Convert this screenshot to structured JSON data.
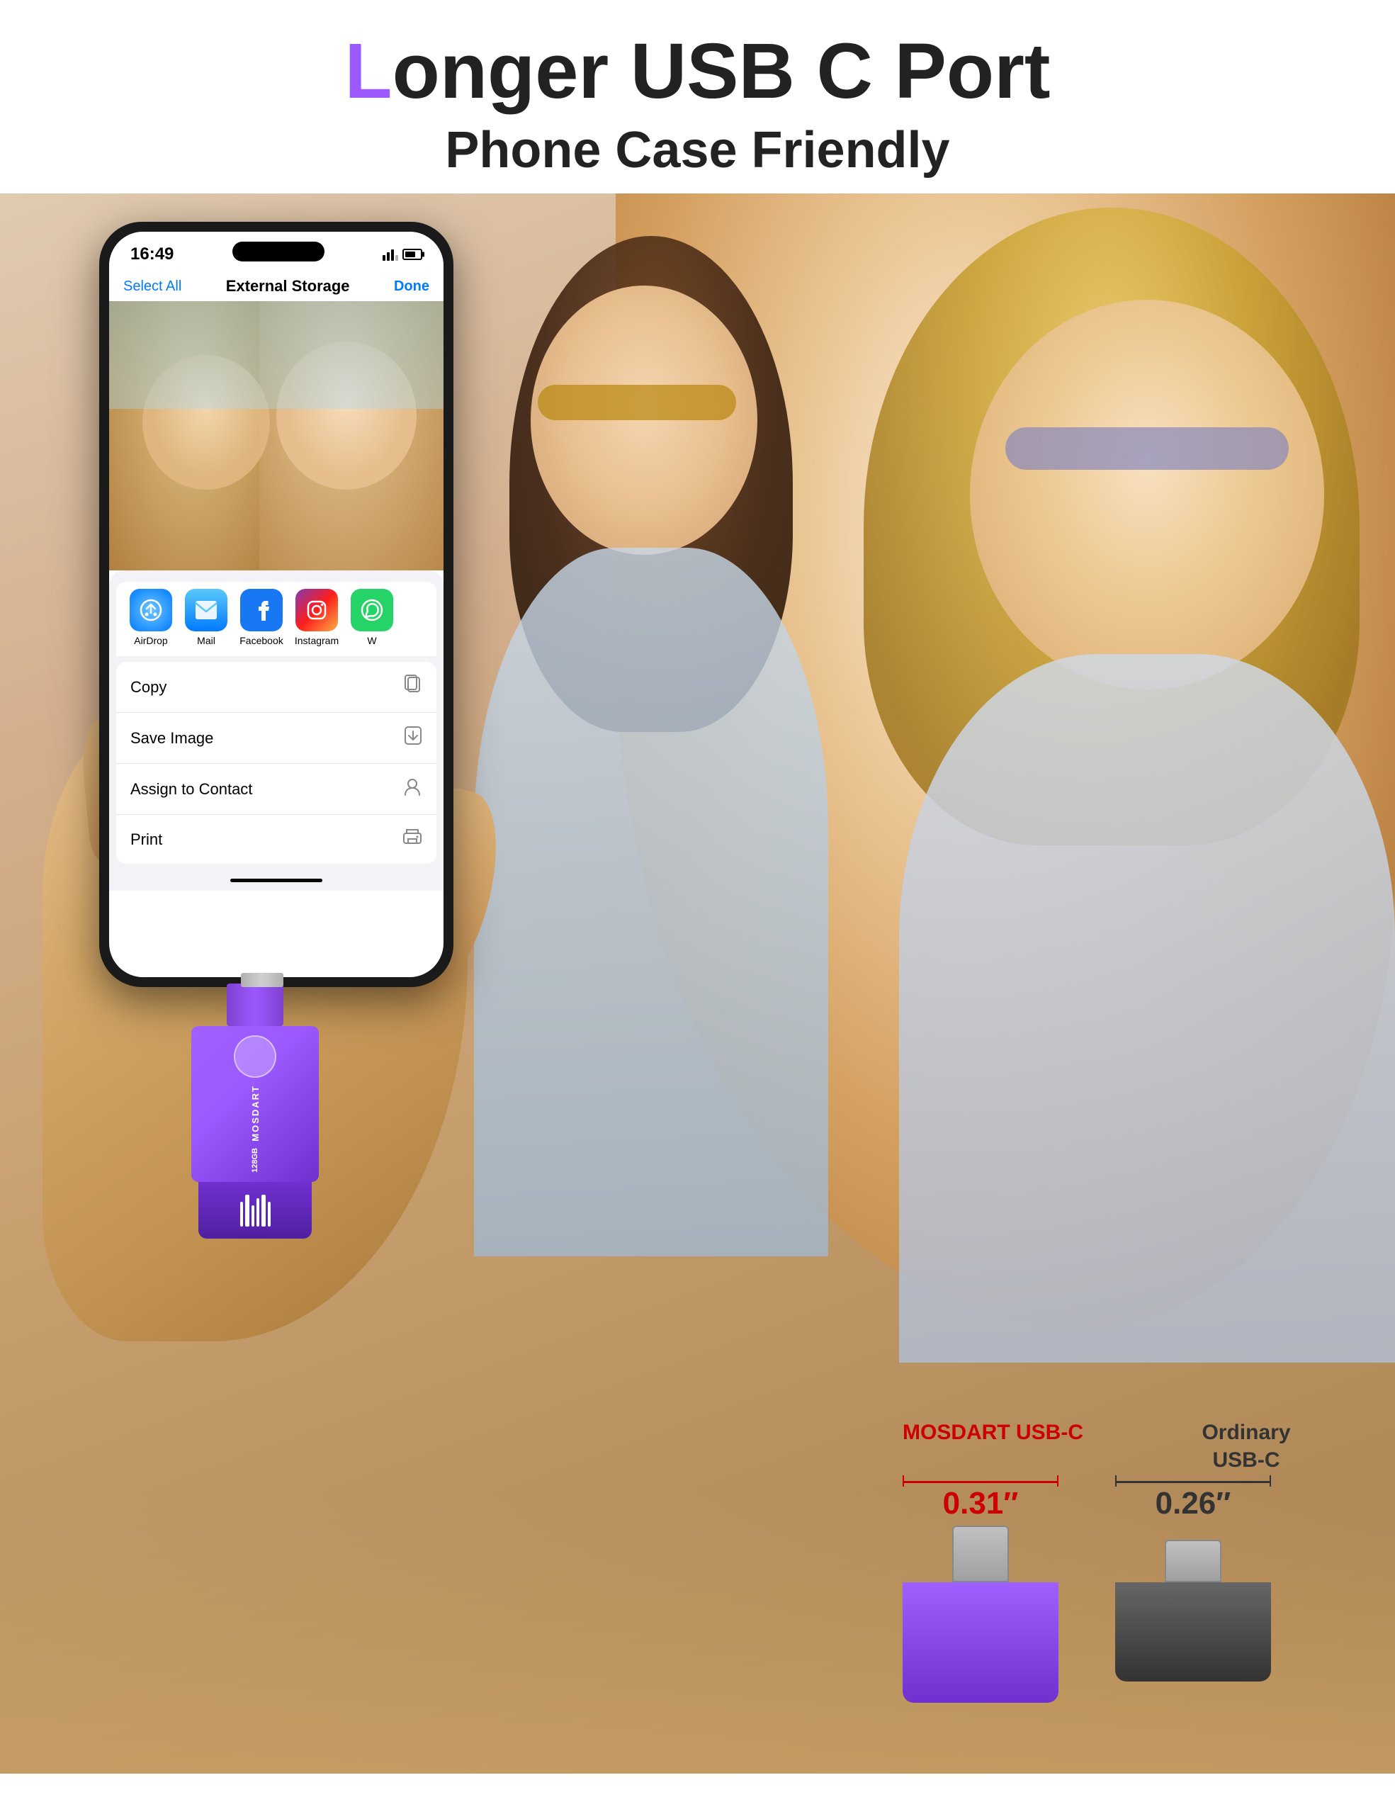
{
  "header": {
    "title_purple": "L",
    "title_black": "onger USB C Port",
    "subtitle": "Phone Case Friendly"
  },
  "phone": {
    "status_time": "16:49",
    "nav_select_all": "Select All",
    "nav_title": "External Storage",
    "nav_done": "Done"
  },
  "share_sheet": {
    "apps": [
      {
        "name": "AirDrop",
        "icon": "airdrop"
      },
      {
        "name": "Mail",
        "icon": "mail"
      },
      {
        "name": "Facebook",
        "icon": "facebook"
      },
      {
        "name": "Instagram",
        "icon": "instagram"
      },
      {
        "name": "W",
        "icon": "whatsapp"
      }
    ],
    "actions": [
      {
        "label": "Copy",
        "icon": "📋"
      },
      {
        "label": "Save Image",
        "icon": "⬆"
      },
      {
        "label": "Assign to Contact",
        "icon": "👤"
      },
      {
        "label": "Print",
        "icon": "🖨"
      }
    ]
  },
  "comparison": {
    "brand_name": "MOSDART\nUSB-C",
    "brand_measurement": "0.31″",
    "ordinary_name": "Ordinary\nUSB-C",
    "ordinary_measurement": "0.26″"
  },
  "usb_drive": {
    "brand": "MOSDART",
    "capacity": "128GB"
  }
}
